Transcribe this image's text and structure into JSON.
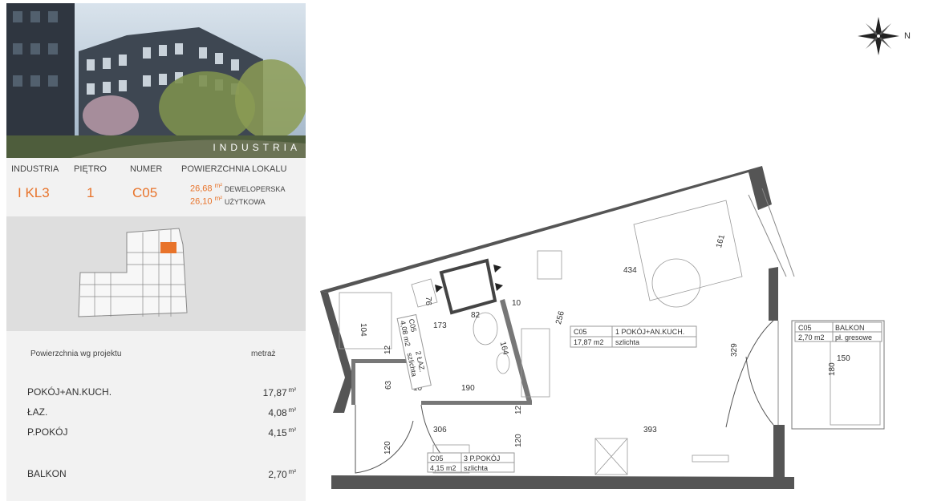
{
  "header": {
    "brand": "INDUSTRIA",
    "col_labels": [
      "INDUSTRIA",
      "PIĘTRO",
      "NUMER",
      "POWIERZCHNIA LOKALU"
    ],
    "building": "I KL3",
    "floor": "1",
    "number": "C05",
    "areas": [
      {
        "value": "26,68",
        "unit": "m²",
        "label": "DEWELOPERSKA"
      },
      {
        "value": "26,10",
        "unit": "m²",
        "label": "UŻYTKOWA"
      }
    ]
  },
  "table": {
    "title": "Powierzchnia wg projektu",
    "unit_header": "metraż",
    "rows": [
      {
        "label": "POKÓJ+AN.KUCH.",
        "value": "17,87",
        "unit": "m²"
      },
      {
        "label": "ŁAZ.",
        "value": "4,08",
        "unit": "m²"
      },
      {
        "label": "P.POKÓJ",
        "value": "4,15",
        "unit": "m²"
      },
      {
        "label": "BALKON",
        "value": "2,70",
        "unit": "m²"
      }
    ]
  },
  "plan": {
    "dims": {
      "d161": "161",
      "d434": "434",
      "d256": "256",
      "d76": "76",
      "d82": "82",
      "d10a": "10",
      "d104": "104",
      "d173": "173",
      "d164": "164",
      "d12a": "12",
      "d63": "63",
      "d10b": "10",
      "d190": "190",
      "d12b": "12",
      "d306": "306",
      "d120a": "120",
      "d120b": "120",
      "d393": "393",
      "d329": "329",
      "d150": "150",
      "d180": "180"
    },
    "rooms": {
      "main": {
        "code": "C05",
        "name": "1 POKÓJ+AN.KUCH.",
        "area": "17,87 m2",
        "finish": "szlichta"
      },
      "bath": {
        "code": "C05",
        "name": "2 ŁAZ.",
        "area": "4,08 m2",
        "finish": "szlichta"
      },
      "hall": {
        "code": "C05",
        "name": "3 P.POKÓJ",
        "area": "4,15 m2",
        "finish": "szlichta"
      },
      "balcony": {
        "code": "C05",
        "name": "BALKON",
        "area": "2,70 m2",
        "finish": "pł. gresowe"
      }
    }
  },
  "compass": {
    "letter": "N",
    "icon": "compass-rose-icon"
  }
}
